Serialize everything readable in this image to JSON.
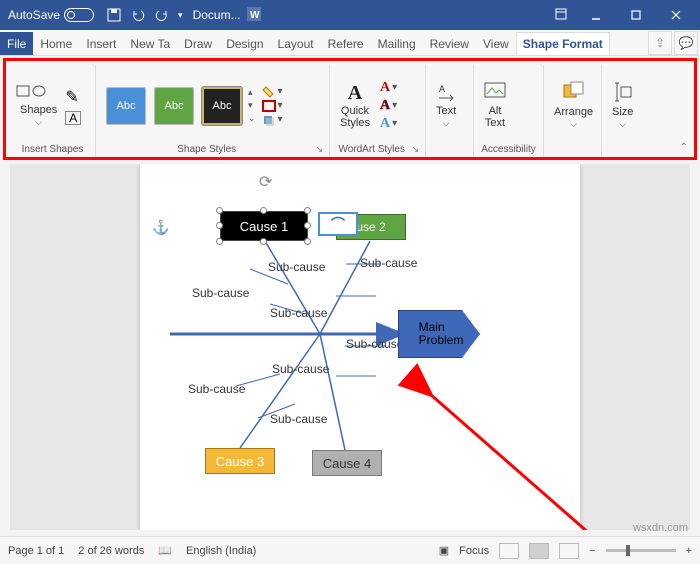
{
  "titlebar": {
    "autosave_label": "AutoSave",
    "autosave_state": "Off",
    "doc_name": "Docum..."
  },
  "tabs": {
    "file": "File",
    "home": "Home",
    "insert": "Insert",
    "newtab": "New Ta",
    "draw": "Draw",
    "design": "Design",
    "layout": "Layout",
    "refere": "Refere",
    "mailing": "Mailing",
    "review": "Review",
    "view": "View",
    "shapeformat": "Shape Format"
  },
  "ribbon": {
    "shapes_label": "Shapes",
    "insert_shapes_group": "Insert Shapes",
    "shape_styles_group": "Shape Styles",
    "wordart_styles_group": "WordArt Styles",
    "text_label": "Text",
    "alt_text_label": "Alt\nText",
    "accessibility_group": "Accessibility",
    "arrange_label": "Arrange",
    "size_label": "Size",
    "style_preview": "Abc",
    "quick_styles_label": "Quick\nStyles"
  },
  "canvas": {
    "cause1": "Cause 1",
    "cause2": "use 2",
    "cause2icon": "⌒",
    "cause3": "Cause 3",
    "cause4": "Cause 4",
    "main_problem": "Main\nProblem",
    "subcause": "Sub-cause"
  },
  "statusbar": {
    "page": "Page 1 of 1",
    "words": "2 of 26 words",
    "language": "English (India)",
    "focus": "Focus"
  },
  "watermark": "wsxdn.com"
}
